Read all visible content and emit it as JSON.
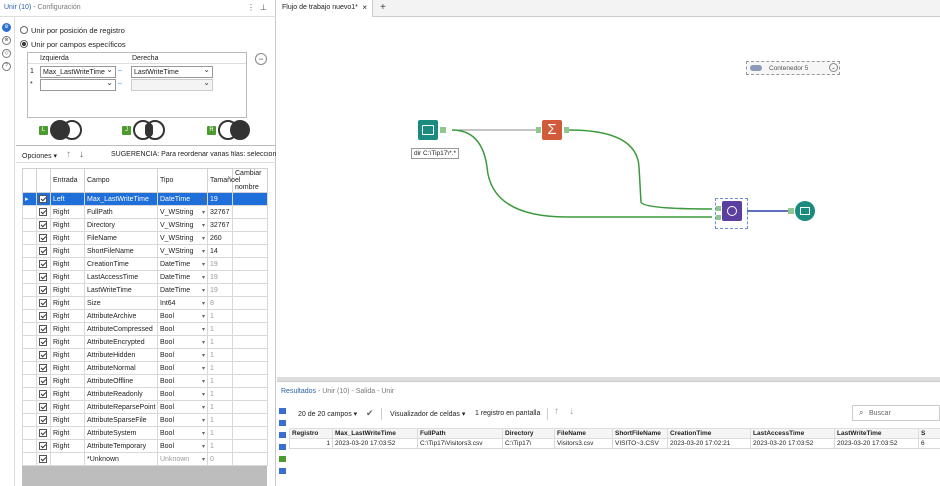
{
  "config": {
    "tool_name": "Unir (10)",
    "separator": " - ",
    "title_suffix": "Configuración",
    "radio_position": "Unir por posición de registro",
    "radio_fields": "Unir por campos específicos",
    "left_header": "Izquierda",
    "right_header": "Derecha",
    "row_num": "1",
    "row_new": "*",
    "left_value": "Max_LastWriteTime",
    "right_value": "LastWriteTime",
    "venn_badges": [
      "L",
      "J",
      "R"
    ],
    "options_label": "Opciones",
    "tip": "SUGERENCIA: Para reordenar varias filas: selecciona, h",
    "columns": [
      "Entrada",
      "Campo",
      "Tipo",
      "Tamaño",
      "Cambiar el nombre"
    ],
    "rows": [
      {
        "entrada": "Left",
        "campo": "Max_LastWriteTime",
        "tipo": "DateTime",
        "tam": "19"
      },
      {
        "entrada": "Right",
        "campo": "FullPath",
        "tipo": "V_WString",
        "tam": "32767"
      },
      {
        "entrada": "Right",
        "campo": "Directory",
        "tipo": "V_WString",
        "tam": "32767"
      },
      {
        "entrada": "Right",
        "campo": "FileName",
        "tipo": "V_WString",
        "tam": "260"
      },
      {
        "entrada": "Right",
        "campo": "ShortFileName",
        "tipo": "V_WString",
        "tam": "14"
      },
      {
        "entrada": "Right",
        "campo": "CreationTime",
        "tipo": "DateTime",
        "tam": "19"
      },
      {
        "entrada": "Right",
        "campo": "LastAccessTime",
        "tipo": "DateTime",
        "tam": "19"
      },
      {
        "entrada": "Right",
        "campo": "LastWriteTime",
        "tipo": "DateTime",
        "tam": "19"
      },
      {
        "entrada": "Right",
        "campo": "Size",
        "tipo": "Int64",
        "tam": "8"
      },
      {
        "entrada": "Right",
        "campo": "AttributeArchive",
        "tipo": "Bool",
        "tam": "1"
      },
      {
        "entrada": "Right",
        "campo": "AttributeCompressed",
        "tipo": "Bool",
        "tam": "1"
      },
      {
        "entrada": "Right",
        "campo": "AttributeEncrypted",
        "tipo": "Bool",
        "tam": "1"
      },
      {
        "entrada": "Right",
        "campo": "AttributeHidden",
        "tipo": "Bool",
        "tam": "1"
      },
      {
        "entrada": "Right",
        "campo": "AttributeNormal",
        "tipo": "Bool",
        "tam": "1"
      },
      {
        "entrada": "Right",
        "campo": "AttributeOffline",
        "tipo": "Bool",
        "tam": "1"
      },
      {
        "entrada": "Right",
        "campo": "AttributeReadonly",
        "tipo": "Bool",
        "tam": "1"
      },
      {
        "entrada": "Right",
        "campo": "AttributeReparsePoint",
        "tipo": "Bool",
        "tam": "1"
      },
      {
        "entrada": "Right",
        "campo": "AttributeSparseFile",
        "tipo": "Bool",
        "tam": "1"
      },
      {
        "entrada": "Right",
        "campo": "AttributeSystem",
        "tipo": "Bool",
        "tam": "1"
      },
      {
        "entrada": "Right",
        "campo": "AttributeTemporary",
        "tipo": "Bool",
        "tam": "1"
      },
      {
        "entrada": "",
        "campo": "*Unknown",
        "tipo": "Unknown",
        "tam": "0"
      }
    ]
  },
  "canvas": {
    "tab_title": "Flujo de trabajo nuevo1*",
    "input_label": "dir C:\\Tip17\\*.*",
    "container_label": "Contenedor 5"
  },
  "results": {
    "title": "Resultados",
    "subtitle": " - Unir (10) - Salida - Unir",
    "fields_count": "20 de 20 campos",
    "cell_viewer": "Visualizador de celdas",
    "records_shown": "1 registro en pantalla",
    "search_placeholder": "Buscar",
    "columns": [
      "Registro",
      "Max_LastWriteTime",
      "FullPath",
      "Directory",
      "FileName",
      "ShortFileName",
      "CreationTime",
      "LastAccessTime",
      "LastWriteTime",
      "S"
    ],
    "row": [
      "1",
      "2023-03-20 17:03:52",
      "C:\\Tip17\\Visitors3.csv",
      "C:\\Tip17\\",
      "Visitors3.csv",
      "VISITO~3.CSV",
      "2023-03-20 17:02:21",
      "2023-03-20 17:03:52",
      "2023-03-20 17:03:52",
      "6"
    ]
  }
}
